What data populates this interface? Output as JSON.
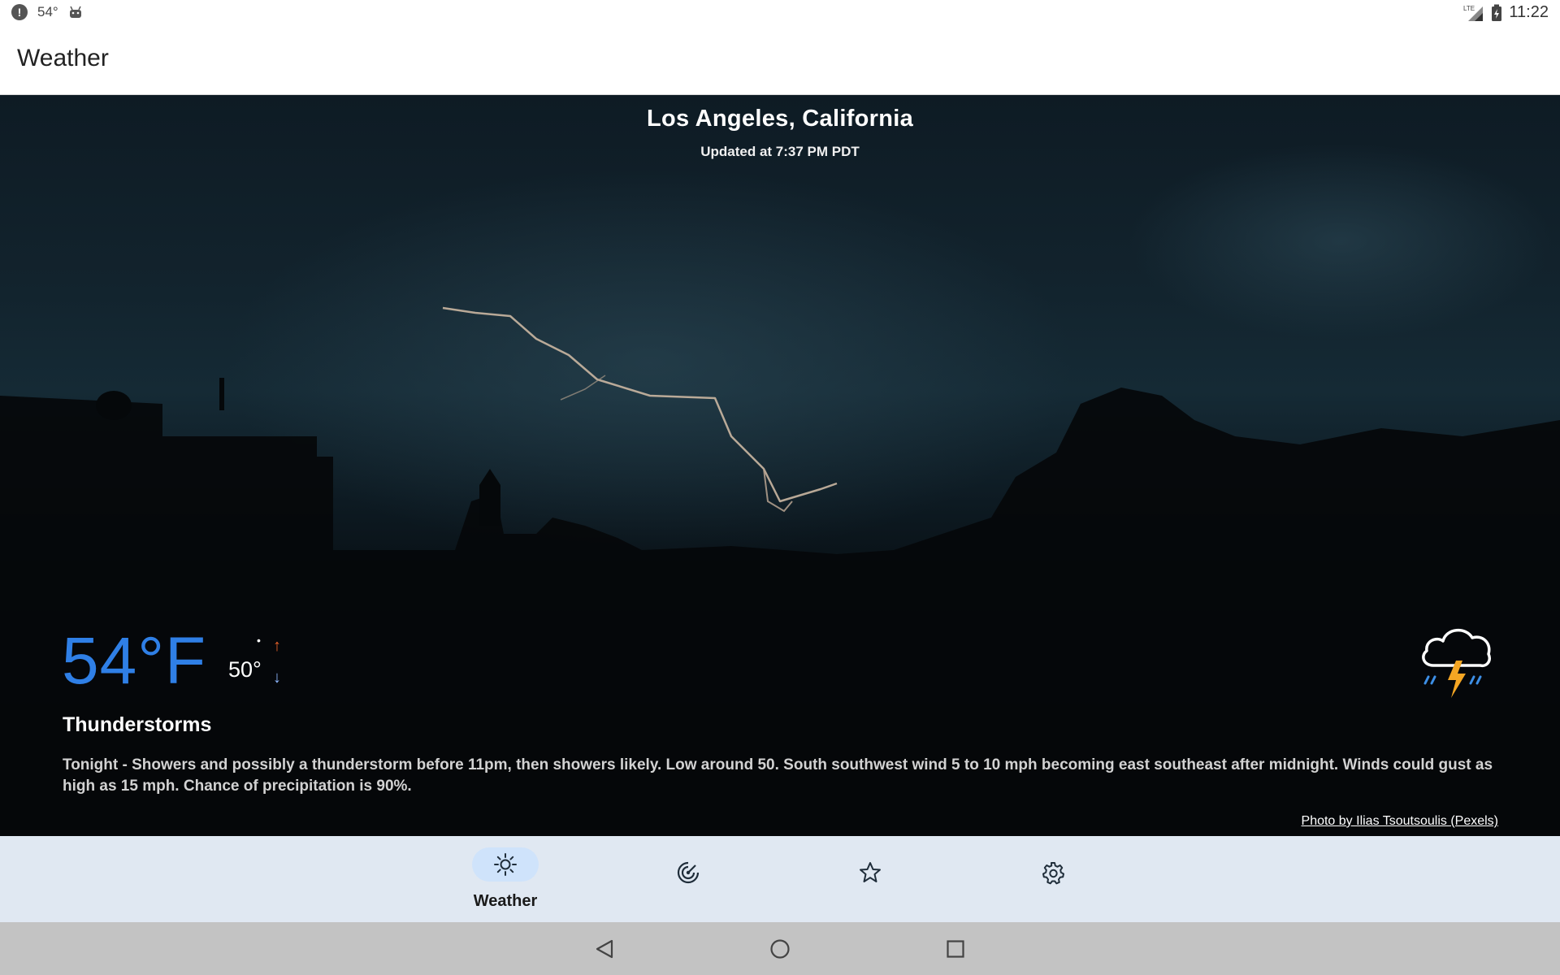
{
  "status_bar": {
    "alert_icon": "alert-circle-icon",
    "temperature": "54°",
    "android_icon": "android-icon",
    "network": "LTE",
    "time": "11:22"
  },
  "app_bar": {
    "title": "Weather"
  },
  "hero": {
    "location": "Los Angeles, California",
    "updated": "Updated at 7:37 PM PDT",
    "current_temp": "54°F",
    "high": "•",
    "low": "50°",
    "condition": "Thunderstorms",
    "forecast": "Tonight - Showers and possibly a thunderstorm before 11pm, then showers likely.  Low around 50. South southwest wind 5 to 10 mph becoming east southeast after midnight. Winds could gust as high as 15 mph.  Chance of precipitation is 90%.",
    "photo_credit": "Photo by Ilias Tsoutsoulis (Pexels)",
    "condition_icon": "thunderstorm-icon"
  },
  "bottom_nav": {
    "items": [
      {
        "label": "Weather",
        "icon": "sun-icon",
        "active": true
      },
      {
        "label": "",
        "icon": "radar-icon",
        "active": false
      },
      {
        "label": "",
        "icon": "star-icon",
        "active": false
      },
      {
        "label": "",
        "icon": "gear-icon",
        "active": false
      }
    ]
  },
  "colors": {
    "temp_blue": "#2f7fe6",
    "nav_background": "#e0e8f2",
    "nav_active_pill": "#cfe3fb",
    "high_arrow": "#e8622a",
    "low_arrow": "#8fb8ff"
  }
}
